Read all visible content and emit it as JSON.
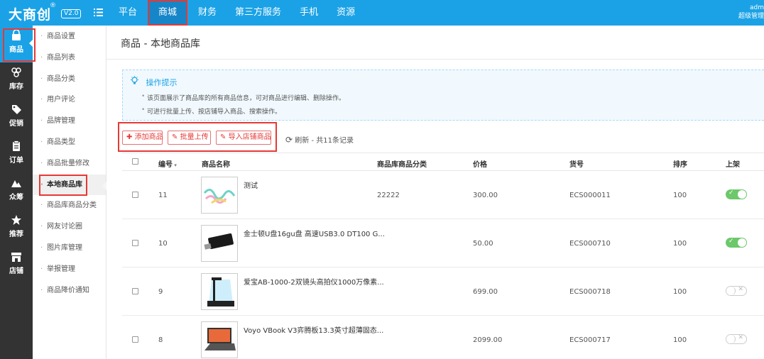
{
  "topbar": {
    "logo": "大商创",
    "logo_mark": "®",
    "version": "V2.0",
    "nav": [
      "平台",
      "商城",
      "财务",
      "第三方服务",
      "手机",
      "资源"
    ],
    "active_nav": "商城",
    "admin_name": "adm",
    "admin_role": "超级管理"
  },
  "sidebar": {
    "items": [
      {
        "label": "商品",
        "icon": "shopping-bag-icon"
      },
      {
        "label": "库存",
        "icon": "warehouse-icon"
      },
      {
        "label": "促销",
        "icon": "tag-icon"
      },
      {
        "label": "订单",
        "icon": "clipboard-icon"
      },
      {
        "label": "众筹",
        "icon": "crowdfunding-icon"
      },
      {
        "label": "推荐",
        "icon": "star-icon"
      },
      {
        "label": "店铺",
        "icon": "store-icon"
      }
    ]
  },
  "subnav": {
    "items": [
      "商品设置",
      "商品列表",
      "商品分类",
      "用户评论",
      "品牌管理",
      "商品类型",
      "商品批量修改",
      "本地商品库",
      "商品库商品分类",
      "网友讨论圈",
      "图片库管理",
      "举报管理",
      "商品降价通知"
    ],
    "active": "本地商品库"
  },
  "page": {
    "title": "商品 - 本地商品库",
    "tips_title": "操作提示",
    "tips": [
      "该页面展示了商品库的所有商品信息，可对商品进行编辑、删除操作。",
      "可进行批量上传、按店铺导入商品、搜索操作。"
    ],
    "buttons": {
      "add": "添加商品",
      "batch": "批量上传",
      "import": "导入店铺商品"
    },
    "refresh_label": "刷新",
    "record_count": "- 共11条记录"
  },
  "table": {
    "columns": [
      "编号",
      "商品名称",
      "商品库商品分类",
      "价格",
      "货号",
      "排序",
      "上架"
    ],
    "rows": [
      {
        "id": "11",
        "name": "测试",
        "category": "22222",
        "price": "300.00",
        "sku": "ECS000011",
        "sort": "100",
        "on_shelf": true,
        "thumb": "cables-thumb"
      },
      {
        "id": "10",
        "name": "金士顿U盘16gu盘 高速USB3.0 DT100 G...",
        "category": "",
        "price": "50.00",
        "sku": "ECS000710",
        "sort": "100",
        "on_shelf": true,
        "thumb": "usb-drive-thumb"
      },
      {
        "id": "9",
        "name": "爱宝AB-1000-2双镜头高拍仪1000万像素...",
        "category": "",
        "price": "699.00",
        "sku": "ECS000718",
        "sort": "100",
        "on_shelf": false,
        "thumb": "scanner-thumb"
      },
      {
        "id": "8",
        "name": "Voyo VBook V3弈腾板13.3英寸超薄固态...",
        "category": "",
        "price": "2099.00",
        "sku": "ECS000717",
        "sort": "100",
        "on_shelf": false,
        "thumb": "laptop-thumb"
      }
    ]
  },
  "colors": {
    "brand": "#1ba2e6",
    "sidebar": "#333333",
    "highlight": "#e53935",
    "toggle_on": "#6cc86a"
  }
}
